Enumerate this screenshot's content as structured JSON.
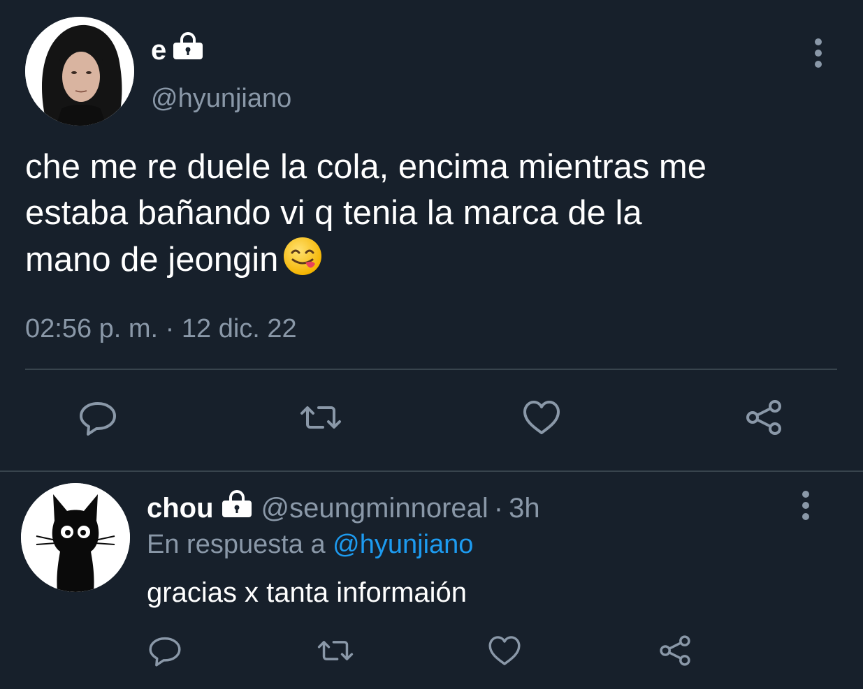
{
  "tweet": {
    "display_name": "e",
    "handle": "@hyunjiano",
    "protected_icon": "lock-icon",
    "text_lines": [
      "che me re duele la cola, encima mientras me",
      "estaba bañando vi q tenia la marca de la",
      "mano de jeongin"
    ],
    "emoji": "face-savoring-food-emoji",
    "timestamp": "02:56 p. m. · 12 dic. 22",
    "actions": [
      "reply-icon",
      "retweet-icon",
      "like-icon",
      "share-icon"
    ]
  },
  "reply": {
    "display_name": "chou",
    "handle": "@seungminnoreal",
    "separator": "·",
    "time": "3h",
    "protected_icon": "lock-icon",
    "in_reply_prefix": "En respuesta a",
    "in_reply_handle": "@hyunjiano",
    "text": "gracias x tanta informaión",
    "actions": [
      "reply-icon",
      "retweet-icon",
      "like-icon",
      "share-icon"
    ]
  },
  "colors": {
    "background": "#17202b",
    "text_primary": "#ffffff",
    "text_secondary": "#8a98a8",
    "link": "#1d9bf0",
    "divider": "#38444d"
  }
}
